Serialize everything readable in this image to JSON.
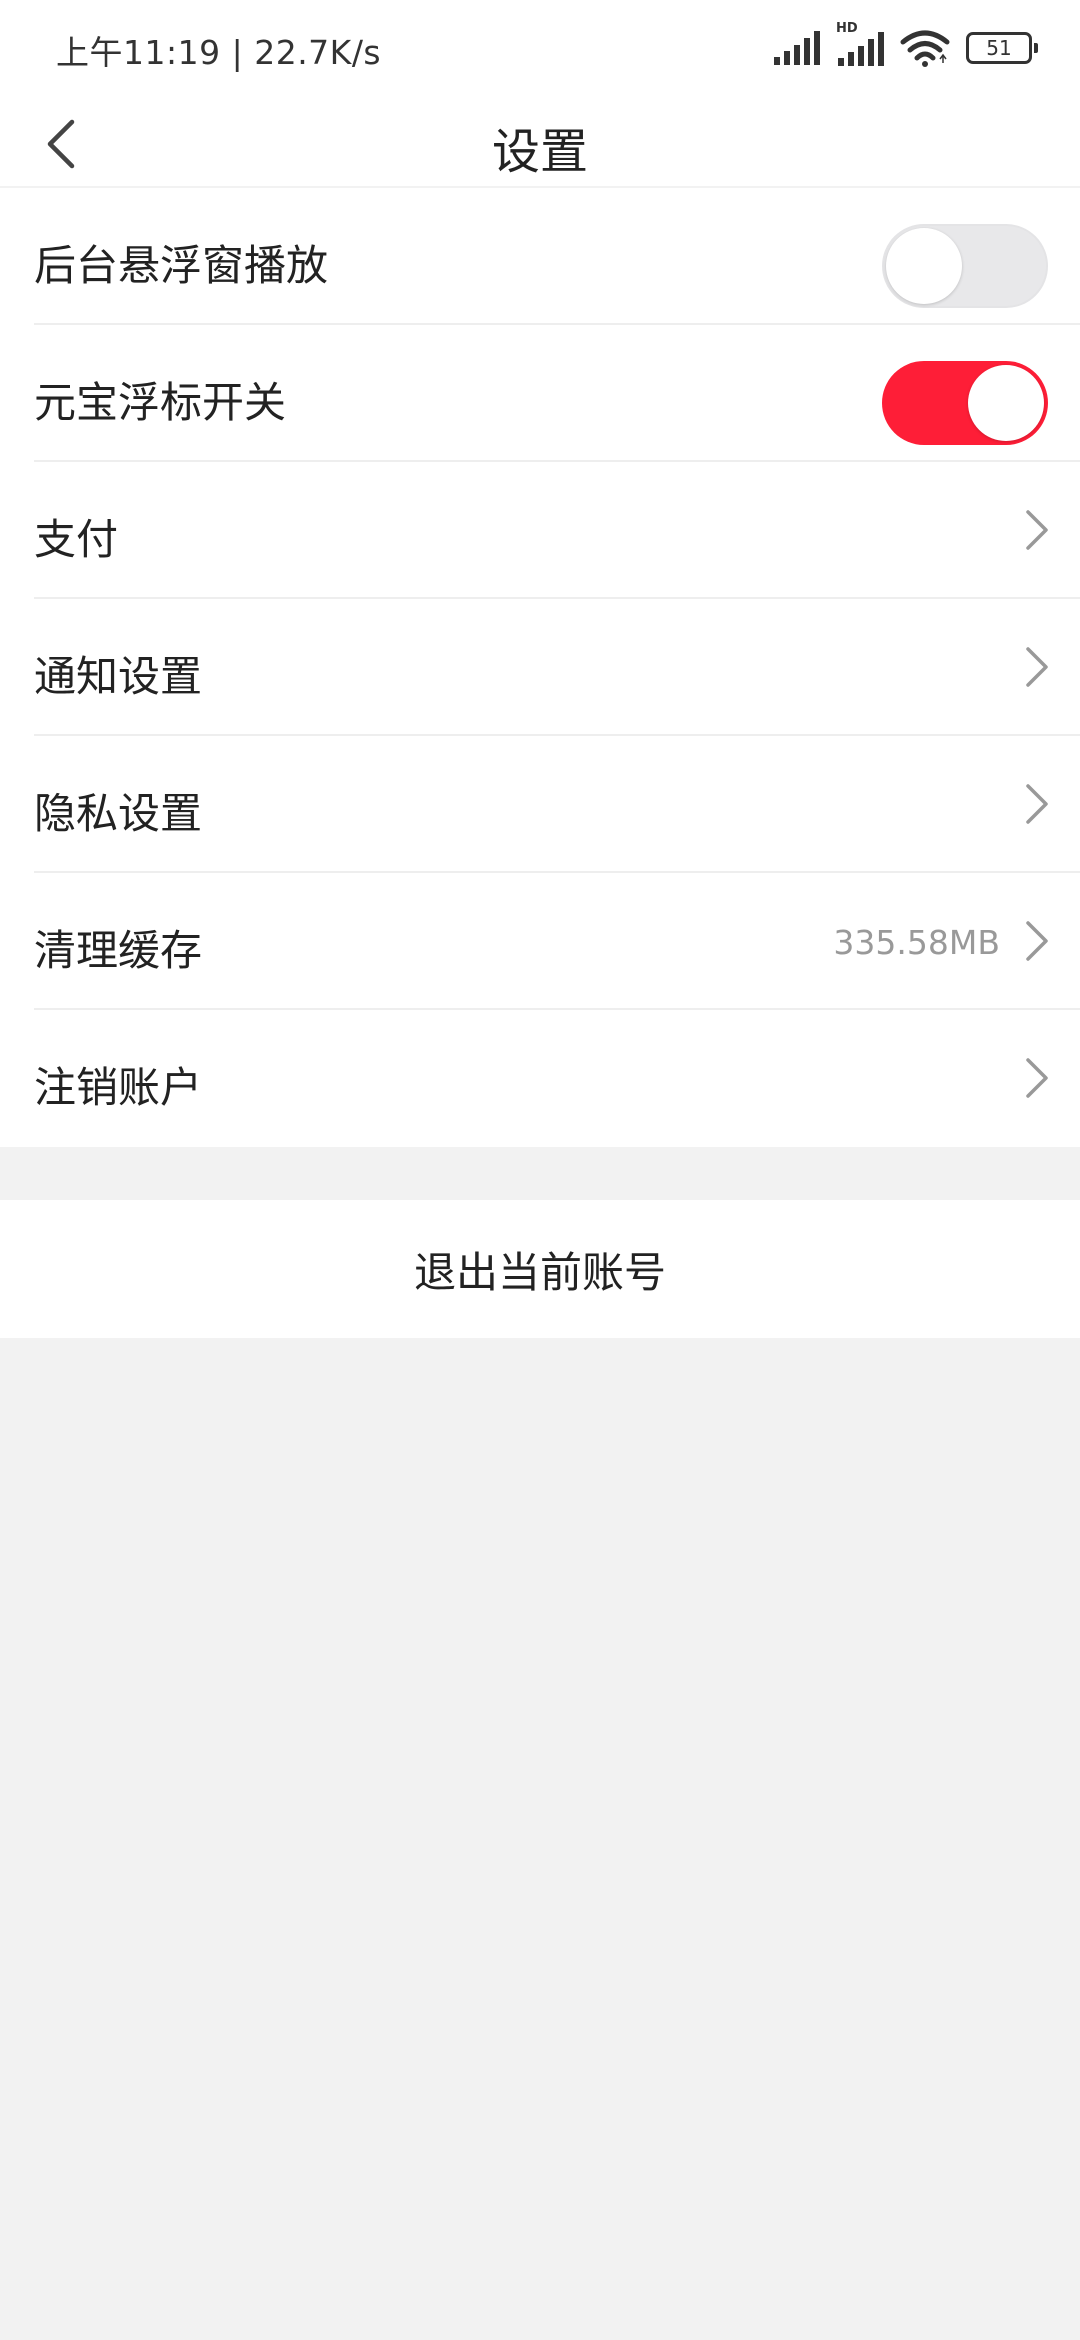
{
  "status_bar": {
    "time": "上午11:19 | 22.7K/s",
    "hd_label": "HD",
    "battery_level": "51",
    "icons": [
      "signal-icon",
      "hd-signal-icon",
      "wifi-icon",
      "battery-icon"
    ]
  },
  "nav": {
    "title": "设置",
    "back_icon": "chevron-left-icon"
  },
  "settings": {
    "items": [
      {
        "label": "后台悬浮窗播放",
        "control": "toggle",
        "on": false
      },
      {
        "label": "元宝浮标开关",
        "control": "toggle",
        "on": true
      },
      {
        "label": "支付",
        "control": "chevron"
      },
      {
        "label": "通知设置",
        "control": "chevron"
      },
      {
        "label": "隐私设置",
        "control": "chevron"
      },
      {
        "label": "清理缓存",
        "control": "chevron",
        "value": "335.58MB"
      },
      {
        "label": "注销账户",
        "control": "chevron"
      }
    ]
  },
  "logout": {
    "label": "退出当前账号"
  },
  "colors": {
    "accent": "#fe1e37",
    "toggle_off": "#e8e8ea",
    "background": "#f2f2f2",
    "chevron": "#999999"
  }
}
